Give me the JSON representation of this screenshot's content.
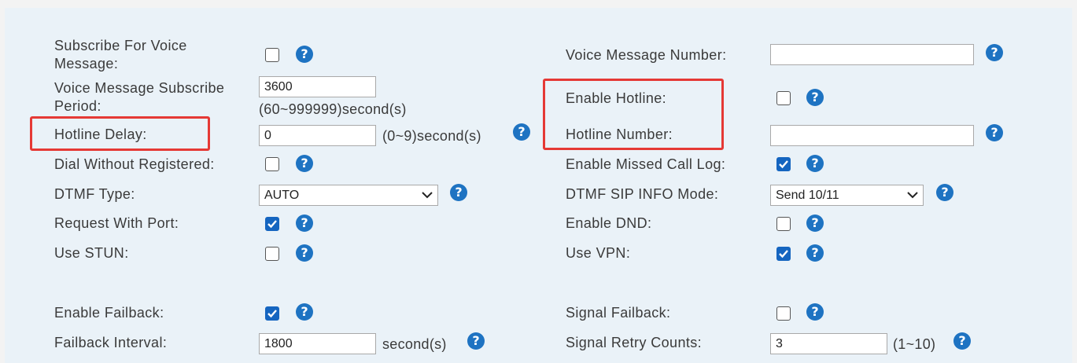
{
  "left": {
    "subscribe_voice_message": {
      "label": "Subscribe For Voice Message:",
      "checked": false
    },
    "voice_message_subscribe_period": {
      "label": "Voice Message Subscribe Period:",
      "value": "3600",
      "hint": "(60~999999)second(s)"
    },
    "hotline_delay": {
      "label": "Hotline Delay:",
      "value": "0",
      "hint": "(0~9)second(s)"
    },
    "dial_without_registered": {
      "label": "Dial Without Registered:",
      "checked": false
    },
    "dtmf_type": {
      "label": "DTMF Type:",
      "selected": "AUTO"
    },
    "request_with_port": {
      "label": "Request With Port:",
      "checked": true
    },
    "use_stun": {
      "label": "Use STUN:",
      "checked": false
    },
    "enable_failback": {
      "label": "Enable Failback:",
      "checked": true
    },
    "failback_interval": {
      "label": "Failback Interval:",
      "value": "1800",
      "hint": "second(s)"
    }
  },
  "right": {
    "voice_message_number": {
      "label": "Voice Message Number:",
      "value": ""
    },
    "enable_hotline": {
      "label": "Enable Hotline:",
      "checked": false
    },
    "hotline_number": {
      "label": "Hotline Number:",
      "value": ""
    },
    "enable_missed_call_log": {
      "label": "Enable Missed Call Log:",
      "checked": true
    },
    "dtmf_sip_info_mode": {
      "label": "DTMF SIP INFO Mode:",
      "selected": "Send 10/11"
    },
    "enable_dnd": {
      "label": "Enable DND:",
      "checked": false
    },
    "use_vpn": {
      "label": "Use VPN:",
      "checked": true
    },
    "signal_failback": {
      "label": "Signal Failback:",
      "checked": false
    },
    "signal_retry_counts": {
      "label": "Signal Retry Counts:",
      "value": "3",
      "hint": "(1~10)"
    }
  },
  "help_glyph": "?",
  "colors": {
    "accent": "#1565c0",
    "help": "#1e73c2",
    "highlight": "#e53935",
    "panel": "#eaf2f8"
  },
  "icons": {
    "help": "question-circle-icon",
    "dropdown": "chevron-down-icon",
    "check": "checkmark-icon"
  }
}
